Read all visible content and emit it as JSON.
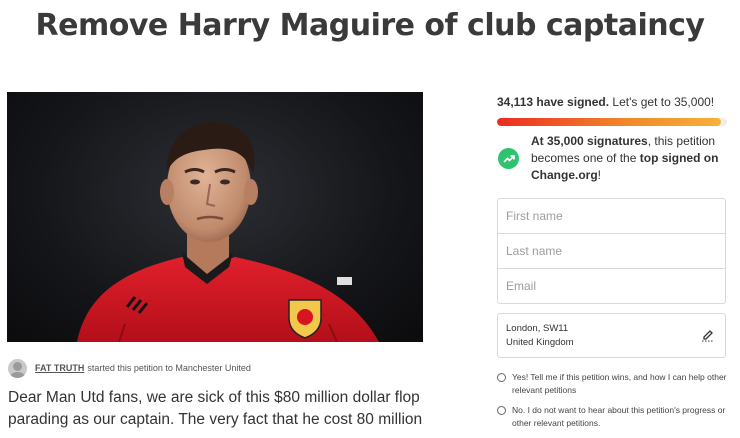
{
  "petition": {
    "title": "Remove Harry Maguire of club captaincy",
    "starter_name": "FAT TRUTH",
    "starter_action": "started this petition to Manchester United",
    "body": "Dear Man Utd fans, we are sick of this $80 million dollar flop parading as our captain. The very fact that he cost 80 million"
  },
  "signatures": {
    "signed_count": "34,113 have signed.",
    "goal_text": "Let's get to 35,000!",
    "progress": 0.975,
    "milestone_bold": "At 35,000 signatures",
    "milestone_mid": ", this petition becomes one of the ",
    "milestone_bold2": "top signed on Change.org",
    "milestone_end": "!"
  },
  "form": {
    "first_name_placeholder": "First name",
    "last_name_placeholder": "Last name",
    "email_placeholder": "Email",
    "location_line1": "London, SW11",
    "location_line2": "United Kingdom",
    "opt_in_label": "Yes! Tell me if this petition wins, and how I can help other relevant petitions",
    "opt_out_label": "No. I do not want to hear about this petition's progress or other relevant petitions."
  },
  "icons": {
    "milestone": "trending-up-icon",
    "location_edit": "pencil-icon",
    "avatar": "user-avatar-icon"
  },
  "colors": {
    "progress_start": "#ec2c22",
    "progress_end": "#f6b13a",
    "milestone_icon": "#2ec271",
    "jersey": "#d7141f"
  }
}
